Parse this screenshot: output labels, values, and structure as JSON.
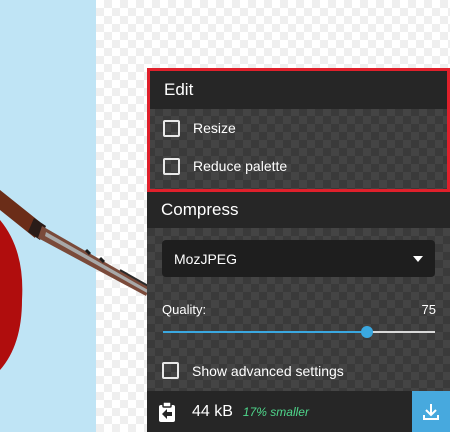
{
  "edit": {
    "title": "Edit",
    "options": [
      {
        "label": "Resize",
        "checked": false
      },
      {
        "label": "Reduce palette",
        "checked": false
      }
    ]
  },
  "compress": {
    "title": "Compress",
    "codec": "MozJPEG",
    "quality_label": "Quality:",
    "quality_value": "75",
    "quality_fraction": 0.75,
    "advanced_label": "Show advanced settings"
  },
  "footer": {
    "size": "44 kB",
    "saving": "17% smaller"
  },
  "colors": {
    "accent": "#3aa8e0",
    "highlight_border": "#e0202b",
    "saving_text": "#4fd88c"
  },
  "icons": [
    "copy-to-other-side-icon",
    "download-icon",
    "chevron-down-icon"
  ]
}
